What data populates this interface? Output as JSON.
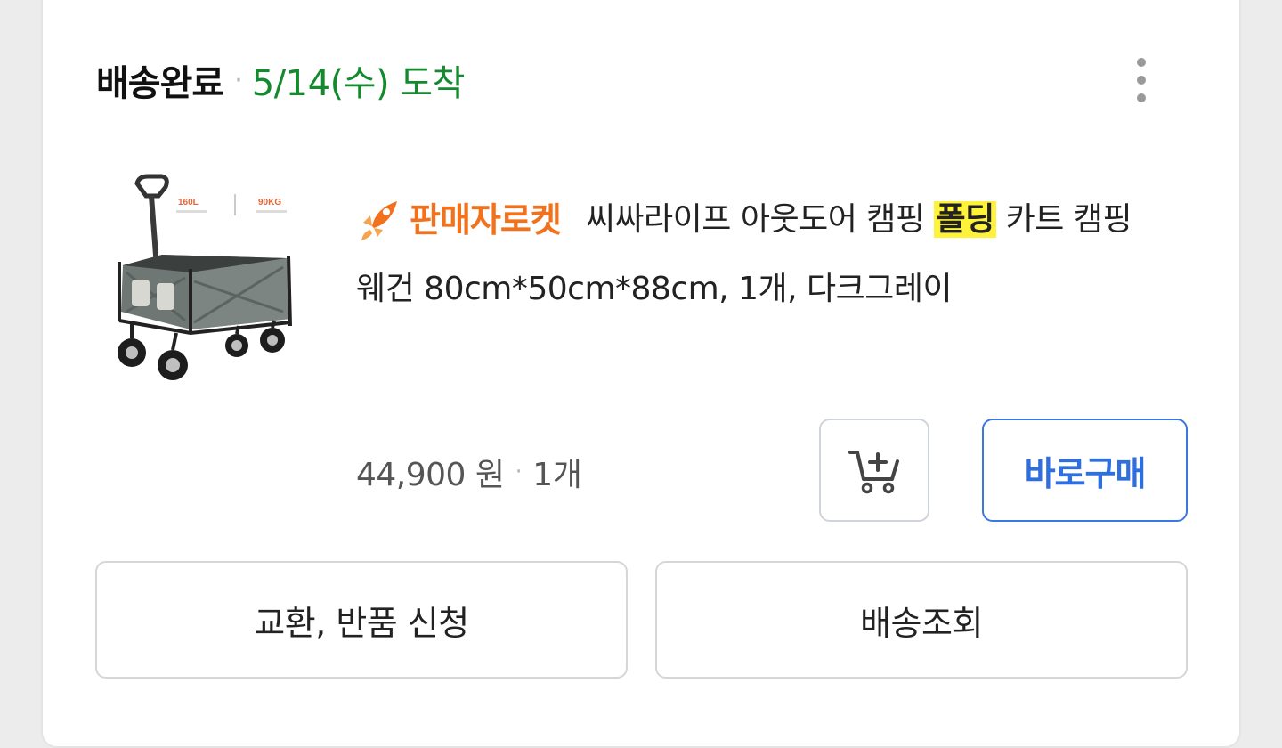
{
  "order": {
    "status_label": "배송완료",
    "separator": "·",
    "arrival_text": "5/14(수) 도착",
    "arrival_color": "#148a2e"
  },
  "more_menu": {
    "icon": "more-vertical-icon"
  },
  "product": {
    "image_icon": "folding-wagon-cart-image",
    "image_text": {
      "capacity": "160L",
      "weight_limit": "90KG"
    },
    "badge_icon": "rocket-icon",
    "badge_text": "판매자로켓",
    "badge_color": "#f2711c",
    "title_before_highlight": "씨싸라이프 아웃도어 캠핑 ",
    "title_highlight": "폴딩",
    "title_after_highlight": " 카트 캠핑 웨건 80cm*50cm*88cm, 1개, 다크그레이",
    "price": "44,900 원",
    "separator": "·",
    "quantity": "1개"
  },
  "actions": {
    "cart_icon": "add-to-cart-icon",
    "buy_now_label": "바로구매",
    "buy_now_color": "#2f6fdd",
    "return_label": "교환, 반품 신청",
    "track_label": "배송조회"
  }
}
